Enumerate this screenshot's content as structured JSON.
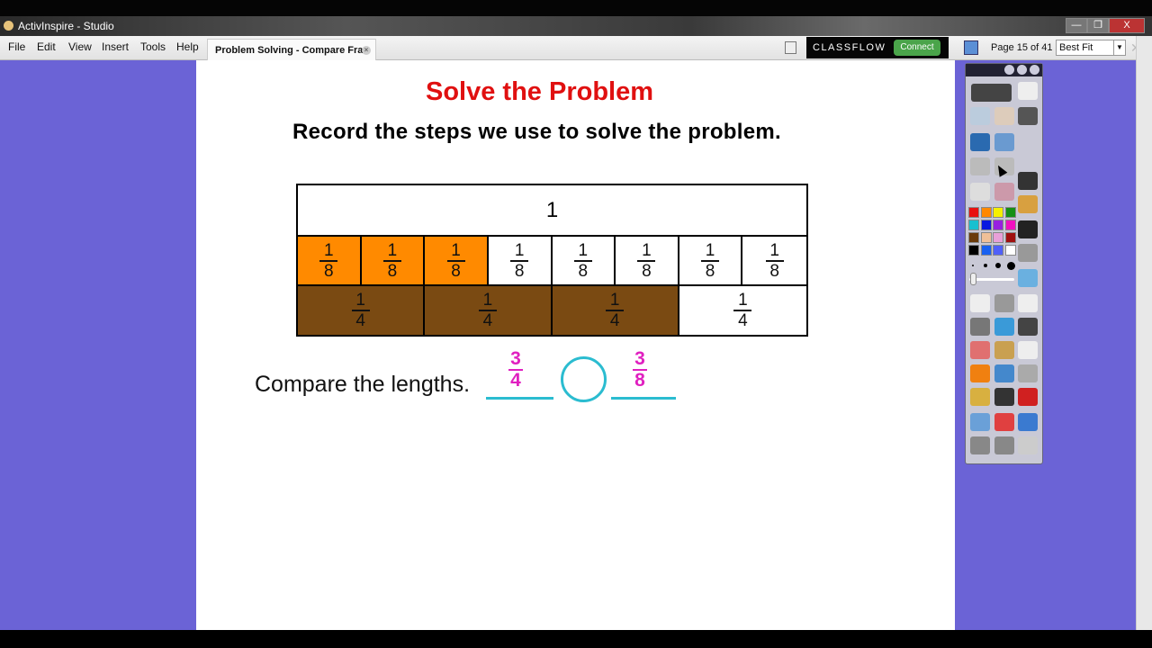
{
  "window": {
    "title": "ActivInspire - Studio",
    "min": "—",
    "max": "❐",
    "close": "X"
  },
  "menu": [
    "File",
    "Edit",
    "View",
    "Insert",
    "Tools",
    "Help"
  ],
  "tab": {
    "label": "Problem Solving - Compare Fra",
    "close": "×"
  },
  "classflow": {
    "label": "CLASSFLOW",
    "connect": "Connect"
  },
  "page_indicator": "Page 15 of 41",
  "zoom": {
    "selected": "Best Fit"
  },
  "expand": "✕",
  "content": {
    "title": "Solve the Problem",
    "subtitle": "Record the steps we use to solve the problem.",
    "whole": "1",
    "eighths": [
      {
        "num": "1",
        "den": "8",
        "color": "#ff8a00"
      },
      {
        "num": "1",
        "den": "8",
        "color": "#ff8a00"
      },
      {
        "num": "1",
        "den": "8",
        "color": "#ff8a00"
      },
      {
        "num": "1",
        "den": "8",
        "color": "#ffffff"
      },
      {
        "num": "1",
        "den": "8",
        "color": "#ffffff"
      },
      {
        "num": "1",
        "den": "8",
        "color": "#ffffff"
      },
      {
        "num": "1",
        "den": "8",
        "color": "#ffffff"
      },
      {
        "num": "1",
        "den": "8",
        "color": "#ffffff"
      }
    ],
    "fourths": [
      {
        "num": "1",
        "den": "4",
        "color": "#7a4a12"
      },
      {
        "num": "1",
        "den": "4",
        "color": "#7a4a12"
      },
      {
        "num": "1",
        "den": "4",
        "color": "#7a4a12"
      },
      {
        "num": "1",
        "den": "4",
        "color": "#ffffff"
      }
    ],
    "compare_label": "Compare the lengths.",
    "left_fraction": {
      "num": "3",
      "den": "4"
    },
    "right_fraction": {
      "num": "3",
      "den": "8"
    },
    "accent_pink": "#e020c0",
    "accent_cyan": "#2bbcd0"
  },
  "toolbox": {
    "palette": [
      "#e81010",
      "#ff8800",
      "#f5f000",
      "#159015",
      "#18c0d0",
      "#0818e0",
      "#9820e0",
      "#f010c0",
      "#6a3a0a",
      "#f0c098",
      "#e8a0d8",
      "#a01010",
      "#000000",
      "#1860f0",
      "#5060f8",
      "#ffffff"
    ]
  }
}
